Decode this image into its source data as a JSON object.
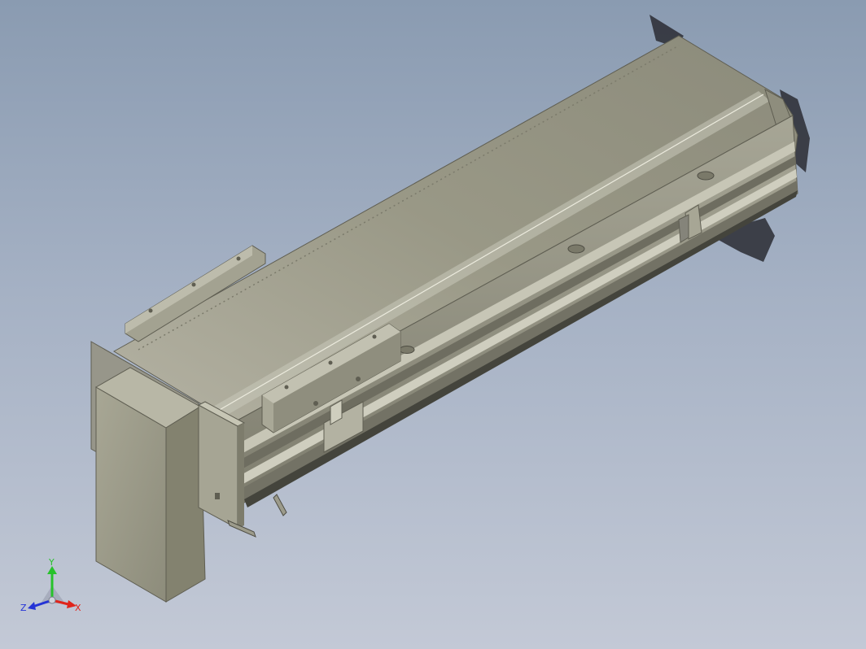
{
  "viewport": {
    "background_top": "#8a9bb1",
    "background_bottom": "#c3c9d6"
  },
  "model": {
    "part_color": "#a09f8e",
    "shade_color": "#6f6d5f",
    "highlight_color": "#d8d7c8"
  },
  "triad": {
    "x_label": "X",
    "y_label": "Y",
    "z_label": "Z",
    "x_color": "#e0241b",
    "y_color": "#27c22b",
    "z_color": "#2433d6"
  }
}
